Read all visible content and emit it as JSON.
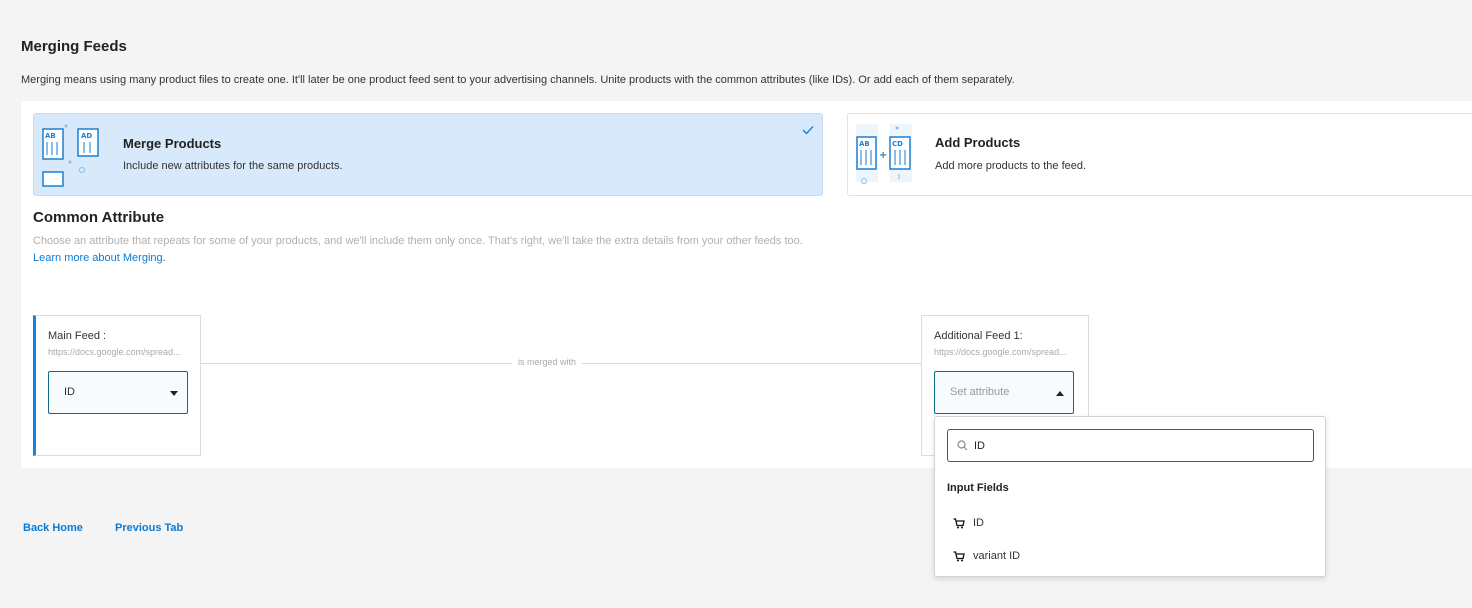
{
  "page": {
    "title": "Merging Feeds",
    "description": "Merging means using many product files to create one. It'll later be one product feed sent to your advertising channels. Unite products with the common attributes (like IDs). Or add each of them separately."
  },
  "modes": [
    {
      "title": "Merge Products",
      "subtitle": "Include new attributes for the same products.",
      "selected": true,
      "illustration_text": [
        "AB",
        "AD"
      ]
    },
    {
      "title": "Add Products",
      "subtitle": "Add more products to the feed.",
      "selected": false,
      "illustration_text": [
        "AB",
        "CD"
      ]
    }
  ],
  "common_attribute": {
    "title": "Common Attribute",
    "description": "Choose an attribute that repeats for some of your products, and we'll include them only once. That's right, we'll take the extra details from your other feeds too.",
    "link": "Learn more about Merging."
  },
  "main_feed": {
    "label": "Main Feed :",
    "url": "https://docs.google.com/spread...",
    "selected": "ID"
  },
  "merge_label": "is merged with",
  "additional_feed": {
    "label": "Additional Feed 1:",
    "url": "https://docs.google.com/spread...",
    "placeholder": "Set attribute"
  },
  "dropdown": {
    "search_value": "ID",
    "group_label": "Input Fields",
    "options": [
      "ID",
      "variant ID"
    ]
  },
  "footer": {
    "back_home": "Back Home",
    "previous_tab": "Previous Tab"
  },
  "colors": {
    "accent": "#0a7bd5",
    "selected_card": "#d7e9fa",
    "field_border": "#0e6a8a",
    "icon_blue": "#1e7fd0"
  }
}
